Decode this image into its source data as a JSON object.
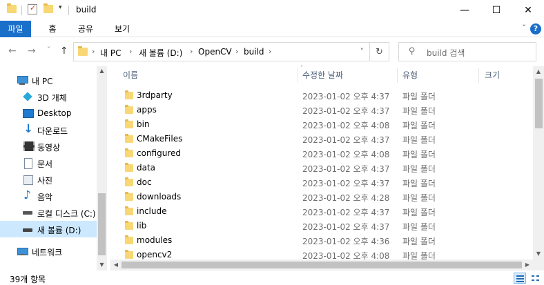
{
  "window": {
    "title": "build",
    "minimize_glyph": "—",
    "maximize_glyph": "☐",
    "close_glyph": "✕"
  },
  "ribbon": {
    "tabs": [
      "파일",
      "홈",
      "공유",
      "보기"
    ],
    "help_label": "?"
  },
  "nav": {
    "back_glyph": "←",
    "forward_glyph": "→",
    "recent_glyph": "˅",
    "up_glyph": "↑",
    "breadcrumbs": [
      "내 PC",
      "새 볼륨 (D:)",
      "OpenCV",
      "build"
    ],
    "search_placeholder": "build 검색"
  },
  "sidebar": {
    "items": [
      {
        "label": "내 PC",
        "icon": "computer-icon"
      },
      {
        "label": "3D 개체",
        "icon": "3d-objects-icon"
      },
      {
        "label": "Desktop",
        "icon": "desktop-icon"
      },
      {
        "label": "다운로드",
        "icon": "download-icon"
      },
      {
        "label": "동영상",
        "icon": "video-icon"
      },
      {
        "label": "문서",
        "icon": "document-icon"
      },
      {
        "label": "사진",
        "icon": "picture-icon"
      },
      {
        "label": "음악",
        "icon": "music-icon"
      },
      {
        "label": "로컬 디스크 (C:)",
        "icon": "drive-icon"
      },
      {
        "label": "새 볼륨 (D:)",
        "icon": "drive-icon",
        "selected": true
      },
      {
        "label": "네트워크",
        "icon": "network-icon"
      }
    ]
  },
  "columns": {
    "name": "이름",
    "date": "수정한 날짜",
    "type": "유형",
    "size": "크기"
  },
  "files": [
    {
      "name": "3rdparty",
      "date": "2023-01-02 오후 4:37",
      "type": "파일 폴더"
    },
    {
      "name": "apps",
      "date": "2023-01-02 오후 4:37",
      "type": "파일 폴더"
    },
    {
      "name": "bin",
      "date": "2023-01-02 오후 4:08",
      "type": "파일 폴더"
    },
    {
      "name": "CMakeFiles",
      "date": "2023-01-02 오후 4:37",
      "type": "파일 폴더"
    },
    {
      "name": "configured",
      "date": "2023-01-02 오후 4:08",
      "type": "파일 폴더"
    },
    {
      "name": "data",
      "date": "2023-01-02 오후 4:37",
      "type": "파일 폴더"
    },
    {
      "name": "doc",
      "date": "2023-01-02 오후 4:37",
      "type": "파일 폴더"
    },
    {
      "name": "downloads",
      "date": "2023-01-02 오후 4:28",
      "type": "파일 폴더"
    },
    {
      "name": "include",
      "date": "2023-01-02 오후 4:37",
      "type": "파일 폴더"
    },
    {
      "name": "lib",
      "date": "2023-01-02 오후 4:37",
      "type": "파일 폴더"
    },
    {
      "name": "modules",
      "date": "2023-01-02 오후 4:36",
      "type": "파일 폴더"
    },
    {
      "name": "opencv2",
      "date": "2023-01-02 오후 4:08",
      "type": "파일 폴더"
    }
  ],
  "status": {
    "item_count": "39개 항목"
  },
  "colors": {
    "accent": "#1a6fc9",
    "selection": "#cce8ff",
    "folder": "#f8d775"
  }
}
